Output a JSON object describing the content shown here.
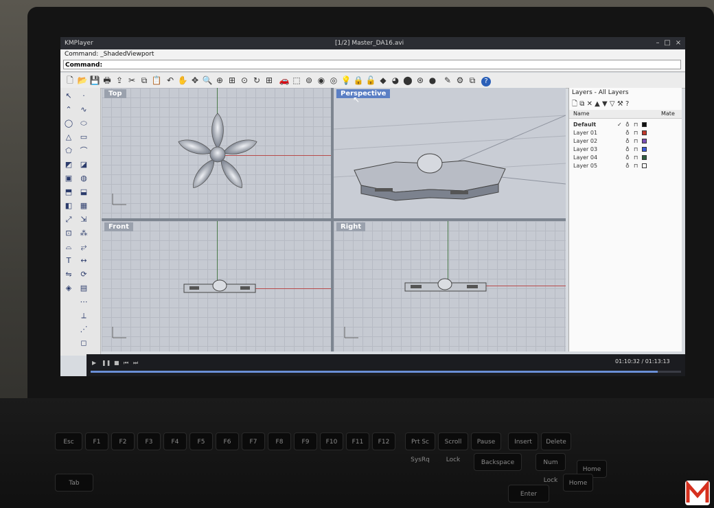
{
  "window": {
    "app_title": "KMPlayer",
    "file_title": "[1/2] Master_DA16.avi"
  },
  "command": {
    "history_line": "Command: _ShadedViewport",
    "prompt_label": "Command:"
  },
  "viewports": {
    "top": "Top",
    "perspective": "Perspective",
    "front": "Front",
    "right": "Right"
  },
  "layers": {
    "title": "Layers - All Layers",
    "col_name": "Name",
    "col_material": "Mate",
    "rows": [
      {
        "name": "Default",
        "color": "#111111",
        "current": "✓"
      },
      {
        "name": "Layer 01",
        "color": "#c0392b",
        "current": ""
      },
      {
        "name": "Layer 02",
        "color": "#7a4fb5",
        "current": ""
      },
      {
        "name": "Layer 03",
        "color": "#3b5bd6",
        "current": ""
      },
      {
        "name": "Layer 04",
        "color": "#2f5d3f",
        "current": ""
      },
      {
        "name": "Layer 05",
        "color": "#ffffff",
        "current": ""
      }
    ]
  },
  "player": {
    "time": "01:10:32 / 01:13:13"
  },
  "keyboard": {
    "keys": [
      "Esc",
      "F1",
      "F2",
      "F3",
      "F4",
      "F5",
      "F6",
      "F7",
      "F8",
      "F9",
      "F10",
      "F11",
      "F12",
      "Prt Sc SysRq",
      "Scroll Lock",
      "Pause Break",
      "Insert",
      "Delete",
      "Home",
      "Backspace",
      "Num Lock",
      "Tab",
      "Enter",
      "Home"
    ]
  }
}
